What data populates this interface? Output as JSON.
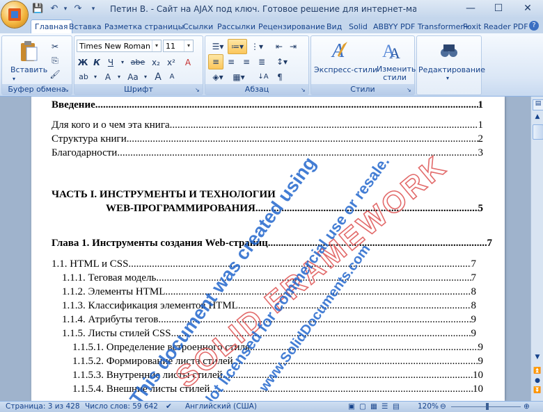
{
  "window": {
    "title": "Петин В. - Сайт на AJAX под ключ. Готовое решение для интернет-магазина (Профес...",
    "controls": {
      "minimize": "—",
      "maximize": "☐",
      "close": "✕"
    }
  },
  "quick_access": {
    "save": "💾",
    "undo": "↶",
    "redo": "↷",
    "more": "▾"
  },
  "tabs": [
    "Главная",
    "Вставка",
    "Разметка страницы",
    "Ссылки",
    "Рассылки",
    "Рецензирование",
    "Вид",
    "Solid",
    "ABBYY PDF Transformer+",
    "Foxit Reader PDF"
  ],
  "ribbon": {
    "clipboard": {
      "label": "Буфер обмена",
      "paste": "Вставить"
    },
    "font": {
      "label": "Шрифт",
      "font_name": "Times New Roman",
      "font_size": "11",
      "bold": "Ж",
      "italic": "К",
      "underline": "Ч",
      "strike": "abe",
      "subscript": "x₂",
      "superscript": "x²",
      "clear": "A",
      "highlight": "ab",
      "color": "A",
      "case": "Aa",
      "grow": "A",
      "shrink": "A"
    },
    "paragraph": {
      "label": "Абзац",
      "pilcrow": "¶",
      "sort": "↓A"
    },
    "styles": {
      "label": "Стили",
      "quick_styles": "Экспресс-стили",
      "change_styles": [
        "Изменить",
        "стили"
      ]
    },
    "editing": {
      "label": "Редактирование"
    }
  },
  "document": {
    "toc": [
      {
        "text": "Введение",
        "page": "1",
        "bold": true
      },
      {
        "text": "Для кого и о чем эта книга",
        "page": "1"
      },
      {
        "text": "Структура книги",
        "page": "2"
      },
      {
        "text": "Благодарности",
        "page": "3"
      },
      {
        "text": "ЧАСТЬ I. ИНСТРУМЕНТЫ И ТЕХНОЛОГИИ",
        "page": "",
        "bold": true
      },
      {
        "text": "WEB-ПРОГРАММИРОВАНИЯ",
        "page": "5",
        "bold": true
      },
      {
        "text": "Глава 1. Инструменты создания Web-страниц",
        "page": "7",
        "bold": true
      },
      {
        "text": "1.1. HTML и CSS",
        "page": "7"
      },
      {
        "text": "1.1.1. Теговая модель",
        "page": "7"
      },
      {
        "text": "1.1.2. Элементы HTML",
        "page": "8"
      },
      {
        "text": "1.1.3. Классификация элементов HTML",
        "page": "8"
      },
      {
        "text": "1.1.4. Атрибуты тегов",
        "page": "9"
      },
      {
        "text": "1.1.5. Листы стилей CSS",
        "page": "9"
      },
      {
        "text": "1.1.5.1. Определение встроенного стиля",
        "page": "9"
      },
      {
        "text": "1.1.5.2. Формирование листа стилей",
        "page": "9"
      },
      {
        "text": "1.1.5.3. Внутренние листы стилей",
        "page": "10"
      },
      {
        "text": "1.1.5.4. Внешние листы стилей",
        "page": "10"
      }
    ],
    "watermark": {
      "line1": "This document was created using",
      "line2": "SOLID FRAMEWORK",
      "line3": "Not licensed for commercial use or resale.",
      "line4": "www.SolidDocuments.com"
    }
  },
  "status_bar": {
    "page": "Страница: 3 из 428",
    "words": "Число слов: 59 642",
    "language": "Английский (США)",
    "zoom": "120%"
  },
  "colors": {
    "accent": "#15428b",
    "watermark_blue": "#2266cc",
    "watermark_red": "#e26a6a"
  }
}
